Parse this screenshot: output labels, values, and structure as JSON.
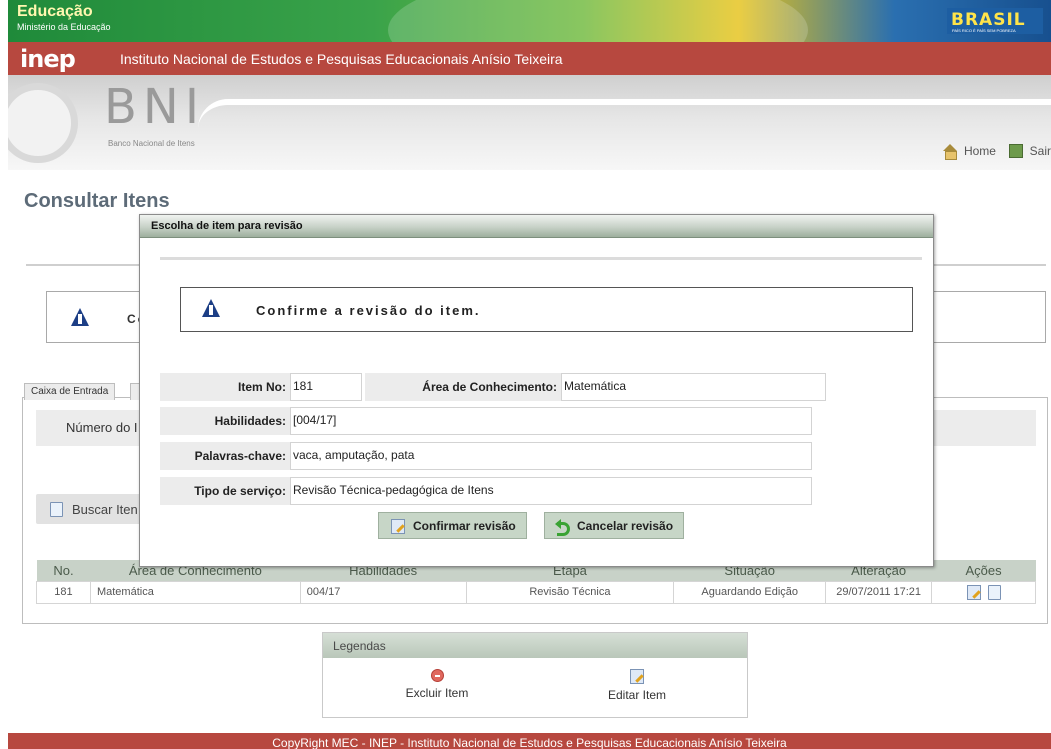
{
  "gov": {
    "title": "Educação",
    "subtitle": "Ministério da Educação",
    "brasil": "BRASIL",
    "brasil_tag": "PAÍS RICO É PAÍS SEM POBREZA"
  },
  "inep": {
    "logo": "inep",
    "name": "Instituto Nacional de Estudos e Pesquisas Educacionais Anísio Teixeira"
  },
  "bni": {
    "logo": "BNI",
    "subtitle": "Banco Nacional de Itens"
  },
  "header_links": {
    "home": "Home",
    "exit": "Sair"
  },
  "page": {
    "title": "Consultar Itens",
    "confirm_bg_text": "Co",
    "tab_label": "Caixa de Entrada",
    "filter_label": "Número do I",
    "search_label": "Buscar Iten"
  },
  "table": {
    "headers": [
      "No.",
      "Área de Conhecimento",
      "Habilidades",
      "Etapa",
      "Situação",
      "Alteração",
      "Ações"
    ],
    "rows": [
      {
        "no": "181",
        "area": "Matemática",
        "hab": "004/17",
        "etapa": "Revisão Técnica",
        "situacao": "Aguardando Edição",
        "alteracao": "29/07/2011 17:21"
      }
    ]
  },
  "legend": {
    "title": "Legendas",
    "delete": "Excluir Item",
    "edit": "Editar Item"
  },
  "footer": "CopyRight MEC - INEP - Instituto Nacional de Estudos e Pesquisas Educacionais Anísio Teixeira",
  "modal": {
    "title": "Escolha de item para revisão",
    "message": "Confirme a revisão do item.",
    "fields": {
      "item_no_label": "Item No:",
      "item_no": "181",
      "area_label": "Área de Conhecimento:",
      "area": "Matemática",
      "hab_label": "Habilidades:",
      "hab": "[004/17]",
      "palavras_label": "Palavras-chave:",
      "palavras": "vaca, amputação, pata",
      "tipo_label": "Tipo de serviço:",
      "tipo": "Revisão Técnica-pedagógica de Itens"
    },
    "confirm_button": "Confirmar revisão",
    "cancel_button": "Cancelar revisão"
  }
}
